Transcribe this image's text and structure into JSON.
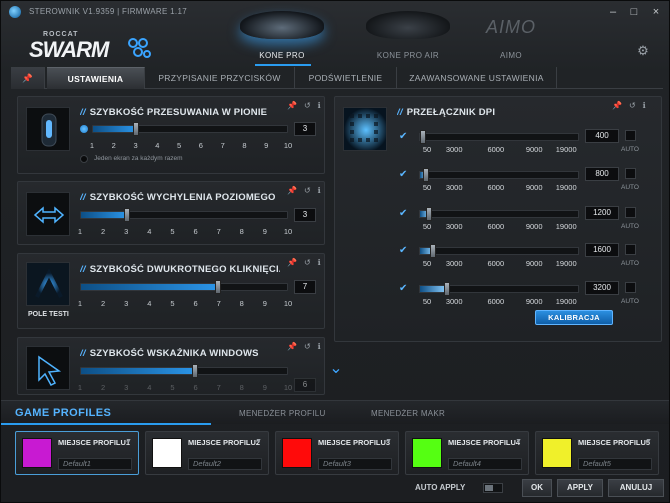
{
  "window": {
    "title": "STEROWNIK V1.9359 | FIRMWARE 1.17",
    "controls": [
      "–",
      "□",
      "×"
    ]
  },
  "logo": {
    "small": "ROCCAT",
    "big": "SWARM"
  },
  "devices": [
    {
      "name": "KONE PRO",
      "selected": true
    },
    {
      "name": "KONE PRO AIR",
      "selected": false
    },
    {
      "name": "AIMO",
      "brand": "AIMO",
      "selected": false
    }
  ],
  "tabs": {
    "pin": "📌",
    "items": [
      {
        "label": "USTAWIENIA",
        "active": true
      },
      {
        "label": "PRZYPISANIE PRZYCISKÓW",
        "active": false
      },
      {
        "label": "PODŚWIETLENIE",
        "active": false
      },
      {
        "label": "ZAAWANSOWANE USTAWIENIA",
        "active": false
      }
    ]
  },
  "panels": {
    "vertical_scroll": {
      "title": "SZYBKOŚĆ PRZESUWANIA W PIONIE",
      "value": "3",
      "level": 3,
      "ticks": [
        "1",
        "2",
        "3",
        "4",
        "5",
        "6",
        "7",
        "8",
        "9",
        "10"
      ],
      "option_label": "Jeden ekran za każdym razem"
    },
    "horizontal_tilt": {
      "title": "SZYBKOŚĆ WYCHYLENIA POZIOMEGO (W",
      "value": "3",
      "level": 3,
      "ticks": [
        "1",
        "2",
        "3",
        "4",
        "5",
        "6",
        "7",
        "8",
        "9",
        "10"
      ]
    },
    "double_click": {
      "title": "SZYBKOŚĆ DWUKROTNEGO KLIKNIĘCIA",
      "value": "7",
      "level": 7,
      "thumb_label": "POLE TESTI",
      "ticks": [
        "1",
        "2",
        "3",
        "4",
        "5",
        "6",
        "7",
        "8",
        "9",
        "10"
      ]
    },
    "pointer_speed": {
      "title": "SZYBKOŚĆ WSKAŹNIKA WINDOWS",
      "value": "6",
      "level": 6,
      "ticks": [
        "1",
        "2",
        "3",
        "4",
        "5",
        "6",
        "7",
        "8",
        "9",
        "10"
      ]
    },
    "dpi": {
      "title": "PRZEŁĄCZNIK DPI",
      "ticks": [
        "50",
        "3000",
        "6000",
        "9000",
        "19000"
      ],
      "auto_label": "AUTO",
      "rows": [
        {
          "value": "400",
          "enabled": true,
          "fraction": 0.02
        },
        {
          "value": "800",
          "enabled": true,
          "fraction": 0.04
        },
        {
          "value": "1200",
          "enabled": true,
          "fraction": 0.06
        },
        {
          "value": "1600",
          "enabled": true,
          "fraction": 0.08
        },
        {
          "value": "3200",
          "enabled": true,
          "fraction": 0.17
        }
      ],
      "calibrate_label": "KALIBRACJA"
    }
  },
  "icons": {
    "pin": "📌",
    "reset": "↺",
    "info": "ℹ",
    "check": "✔",
    "scroll_down": "⌄",
    "gear": "⚙",
    "caret": "▼"
  },
  "profiles": {
    "title": "GAME PROFILES",
    "tabs": [
      "MENEDŻER PROFILU",
      "MENEDŻER MAKR"
    ],
    "slots": [
      {
        "name": "MIEJSCE PROFILU1",
        "field": "Default1",
        "color": "#c81ad2",
        "active": true
      },
      {
        "name": "MIEJSCE PROFILU2",
        "field": "Default2",
        "color": "#ffffff",
        "active": false
      },
      {
        "name": "MIEJSCE PROFILU3",
        "field": "Default3",
        "color": "#ff0a0a",
        "active": false
      },
      {
        "name": "MIEJSCE PROFILU4",
        "field": "Default4",
        "color": "#55ff12",
        "active": false
      },
      {
        "name": "MIEJSCE PROFILU5",
        "field": "Default5",
        "color": "#f0f02a",
        "active": false
      }
    ]
  },
  "footer": {
    "auto_apply": "AUTO APPLY",
    "ok": "OK",
    "apply": "APPLY",
    "cancel": "ANULUJ"
  },
  "colors": {
    "accent": "#2a9cf0",
    "title_slash": "#59b4ff"
  }
}
